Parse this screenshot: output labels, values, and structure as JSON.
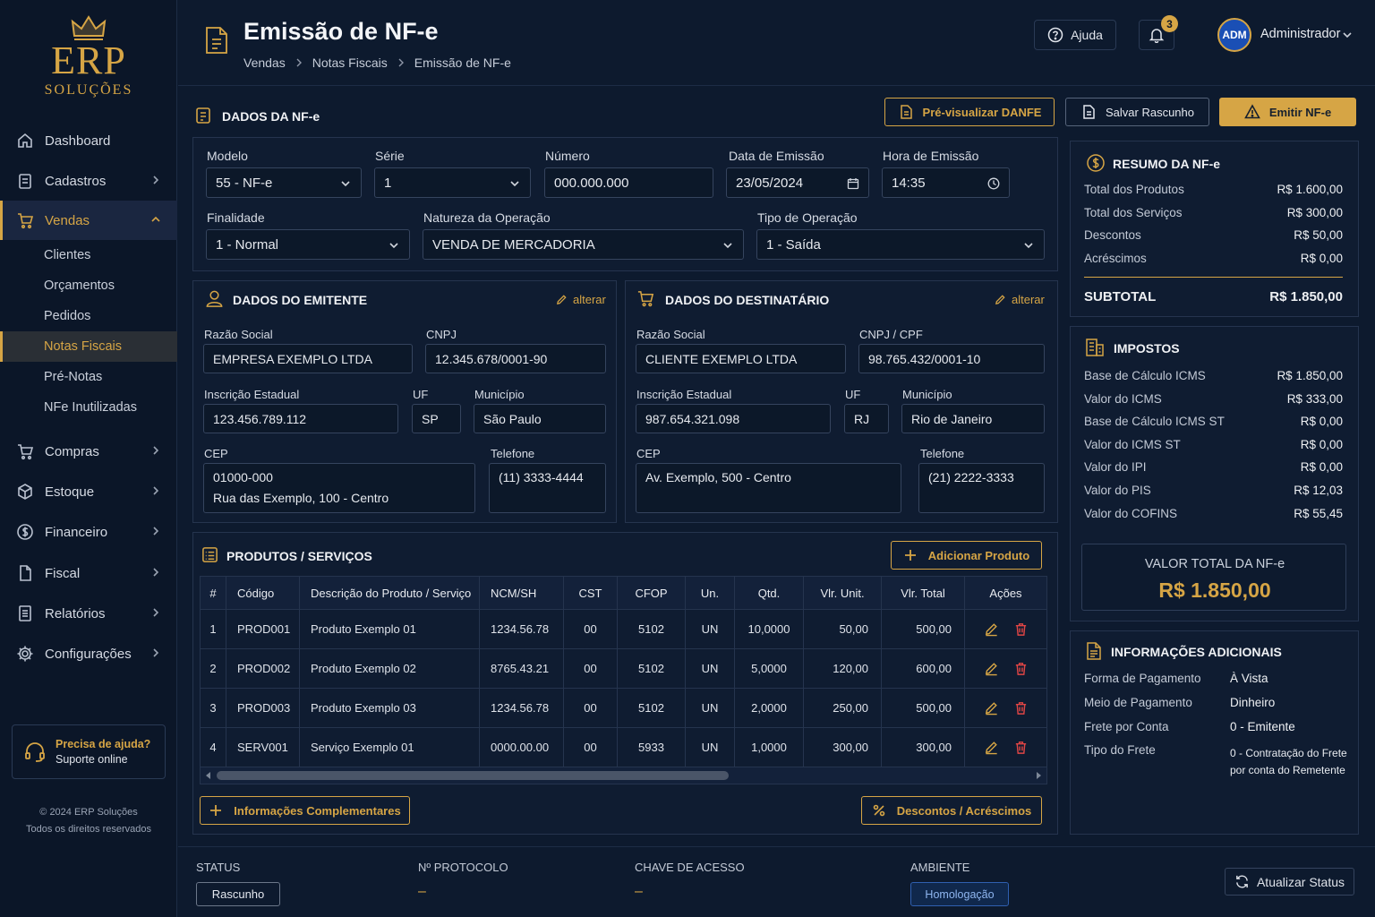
{
  "brand": {
    "name": "ERP",
    "tagline": "SOLUÇÕES"
  },
  "sidebar": {
    "items": [
      {
        "label": "Dashboard",
        "icon": "home-icon"
      },
      {
        "label": "Cadastros",
        "icon": "clipboard-icon"
      },
      {
        "label": "Vendas",
        "icon": "cart-icon"
      },
      {
        "label": "Compras",
        "icon": "cart-icon"
      },
      {
        "label": "Estoque",
        "icon": "box-icon"
      },
      {
        "label": "Financeiro",
        "icon": "dollar-icon"
      },
      {
        "label": "Fiscal",
        "icon": "document-icon"
      },
      {
        "label": "Relatórios",
        "icon": "report-icon"
      },
      {
        "label": "Configurações",
        "icon": "gear-icon"
      }
    ],
    "sub_items": [
      "Clientes",
      "Orçamentos",
      "Pedidos",
      "Notas Fiscais",
      "Pré-Notas",
      "NFe Inutilizadas"
    ],
    "help_title": "Precisa de ajuda?",
    "help_subtitle": "Suporte online",
    "copyright_line1": "© 2024 ERP Soluções",
    "copyright_line2": "Todos os direitos reservados"
  },
  "header": {
    "title": "Emissão de NF-e",
    "breadcrumb": [
      "Vendas",
      "Notas Fiscais",
      "Emissão de NF-e"
    ],
    "help_label": "Ajuda",
    "notification_count": "3",
    "avatar_initials": "ADM",
    "user_name": "Administrador"
  },
  "section": {
    "title": "DADOS DA NF-e",
    "preview_label": "Pré-visualizar DANFE",
    "save_label": "Salvar Rascunho",
    "emit_label": "Emitir NF-e"
  },
  "nfe": {
    "modelo_label": "Modelo",
    "modelo": "55 - NF-e",
    "serie_label": "Série",
    "serie": "1",
    "numero_label": "Número",
    "numero": "000.000.000",
    "data_label": "Data de Emissão",
    "data": "23/05/2024",
    "hora_label": "Hora de Emissão",
    "hora": "14:35",
    "finalidade_label": "Finalidade",
    "finalidade": "1 - Normal",
    "natureza_label": "Natureza da Operação",
    "natureza": "VENDA DE MERCADORIA",
    "tipo_label": "Tipo de Operação",
    "tipo": "1 - Saída"
  },
  "emitente": {
    "title": "DADOS DO EMITENTE",
    "edit_label": "alterar",
    "razao_label": "Razão Social",
    "razao": "EMPRESA EXEMPLO LTDA",
    "cnpj_label": "CNPJ",
    "cnpj": "12.345.678/0001-90",
    "ie_label": "Inscrição Estadual",
    "ie": "123.456.789.112",
    "uf_label": "UF",
    "uf": "SP",
    "mun_label": "Município",
    "mun": "São Paulo",
    "cep_label": "CEP",
    "cep": "01000-000",
    "endereco": "Rua das Exemplo, 100 - Centro",
    "tel_label": "Telefone",
    "tel": "(11) 3333-4444"
  },
  "destinatario": {
    "title": "DADOS DO DESTINATÁRIO",
    "edit_label": "alterar",
    "razao_label": "Razão Social",
    "razao": "CLIENTE EXEMPLO LTDA",
    "cnpj_label": "CNPJ / CPF",
    "cnpj": "98.765.432/0001-10",
    "ie_label": "Inscrição Estadual",
    "ie": "987.654.321.098",
    "uf_label": "UF",
    "uf": "RJ",
    "mun_label": "Município",
    "mun": "Rio de Janeiro",
    "cep_label": "CEP",
    "cep": "Av. Exemplo, 500 - Centro",
    "tel_label": "Telefone",
    "tel": "(21) 2222-3333"
  },
  "produtos": {
    "title": "PRODUTOS / SERVIÇOS",
    "add_label": "Adicionar Produto",
    "columns": [
      "#",
      "Código",
      "Descrição do Produto / Serviço",
      "NCM/SH",
      "CST",
      "CFOP",
      "Un.",
      "Qtd.",
      "Vlr. Unit.",
      "Vlr. Total",
      "Ações"
    ],
    "rows": [
      [
        "1",
        "PROD001",
        "Produto Exemplo 01",
        "1234.56.78",
        "00",
        "5102",
        "UN",
        "10,0000",
        "50,00",
        "500,00"
      ],
      [
        "2",
        "PROD002",
        "Produto Exemplo 02",
        "8765.43.21",
        "00",
        "5102",
        "UN",
        "5,0000",
        "120,00",
        "600,00"
      ],
      [
        "3",
        "PROD003",
        "Produto Exemplo 03",
        "1234.56.78",
        "00",
        "5102",
        "UN",
        "2,0000",
        "250,00",
        "500,00"
      ],
      [
        "4",
        "SERV001",
        "Serviço Exemplo 01",
        "0000.00.00",
        "00",
        "5933",
        "UN",
        "1,0000",
        "300,00",
        "300,00"
      ]
    ],
    "info_label": "Informações Complementares",
    "disc_label": "Descontos / Acréscimos"
  },
  "resumo": {
    "title": "RESUMO DA NF-e",
    "rows": [
      [
        "Total dos Produtos",
        "R$ 1.600,00"
      ],
      [
        "Total dos Serviços",
        "R$ 300,00"
      ],
      [
        "Descontos",
        "R$ 50,00"
      ],
      [
        "Acréscimos",
        "R$ 0,00"
      ]
    ],
    "subtotal_label": "SUBTOTAL",
    "subtotal": "R$ 1.850,00"
  },
  "impostos": {
    "title": "IMPOSTOS",
    "rows": [
      [
        "Base de Cálculo ICMS",
        "R$ 1.850,00"
      ],
      [
        "Valor do ICMS",
        "R$ 333,00"
      ],
      [
        "Base de Cálculo ICMS ST",
        "R$ 0,00"
      ],
      [
        "Valor do ICMS ST",
        "R$ 0,00"
      ],
      [
        "Valor do IPI",
        "R$ 0,00"
      ],
      [
        "Valor do PIS",
        "R$ 12,03"
      ],
      [
        "Valor do COFINS",
        "R$ 55,45"
      ]
    ],
    "total_label": "VALOR TOTAL DA NF-e",
    "total": "R$ 1.850,00"
  },
  "info": {
    "title": "INFORMAÇÕES ADICIONAIS",
    "rows": [
      [
        "Forma de Pagamento",
        "À Vista"
      ],
      [
        "Meio de Pagamento",
        "Dinheiro"
      ],
      [
        "Frete por Conta",
        "0 - Emitente"
      ]
    ],
    "frete_label": "Tipo do Frete",
    "frete_line1": "0 - Contratação do Frete",
    "frete_line2": "por conta do Remetente"
  },
  "status": {
    "status_label": "STATUS",
    "status": "Rascunho",
    "protocolo_label": "Nº PROTOCOLO",
    "protocolo": "–",
    "chave_label": "CHAVE DE ACESSO",
    "chave": "–",
    "ambiente_label": "AMBIENTE",
    "ambiente": "Homologação",
    "refresh_label": "Atualizar Status"
  },
  "colors": {
    "accent": "#d6a545",
    "background": "#0d1a2e",
    "panel": "#0f1c31",
    "danger": "#e04545"
  }
}
